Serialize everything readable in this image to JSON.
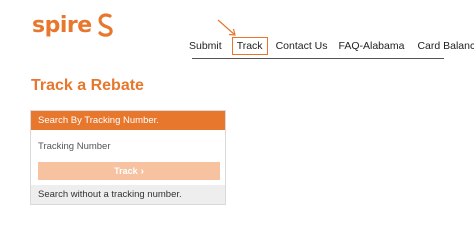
{
  "brand": {
    "name": "spire",
    "color": "#e8772e",
    "icon": "spire-swirl-icon"
  },
  "nav": {
    "items": [
      {
        "label": "Submit"
      },
      {
        "label": "Track"
      },
      {
        "label": "Contact Us"
      },
      {
        "label": "FAQ-Alabama"
      },
      {
        "label": "Card Balance"
      }
    ],
    "highlighted_index": 1,
    "highlight_color": "#e8772e"
  },
  "pointer": {
    "icon": "arrow-pointer-icon",
    "points_to": "Track"
  },
  "page": {
    "title": "Track a Rebate"
  },
  "panel": {
    "header": "Search By Tracking Number.",
    "field_label": "Tracking Number",
    "button_label": "Track",
    "button_icon": "chevron-right-icon",
    "footer_link": "Search without a tracking number."
  }
}
